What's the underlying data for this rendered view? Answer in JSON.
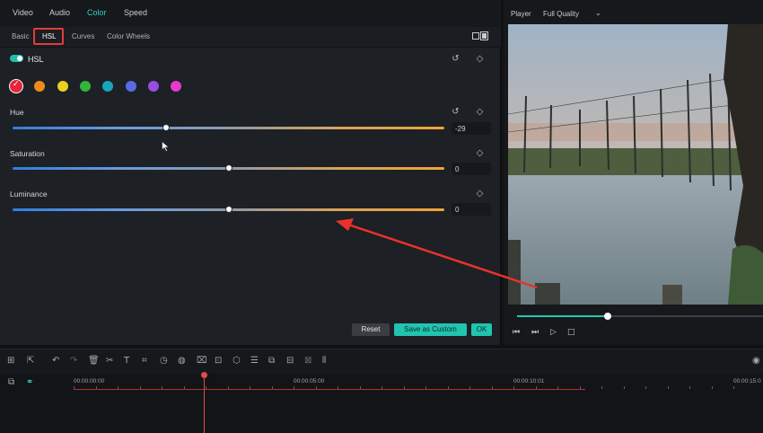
{
  "tabs": [
    {
      "label": "Video"
    },
    {
      "label": "Audio"
    },
    {
      "label": "Color"
    },
    {
      "label": "Speed"
    }
  ],
  "subtabs": [
    {
      "label": "Basic"
    },
    {
      "label": "HSL"
    },
    {
      "label": "Curves"
    },
    {
      "label": "Color Wheels"
    }
  ],
  "hsl": {
    "title": "HSL",
    "enabled": true,
    "swatch_colors": [
      "#e5253a",
      "#f08a1c",
      "#e6d21f",
      "#35b43a",
      "#17a7b7",
      "#5a6be6",
      "#9a4ee0",
      "#e33bd1"
    ],
    "selected_swatch": 0,
    "sliders": [
      {
        "label": "Hue",
        "value": "-29",
        "level": 0.355
      },
      {
        "label": "Saturation",
        "value": "0",
        "level": 0.5
      },
      {
        "label": "Luminance",
        "value": "0",
        "level": 0.5
      }
    ]
  },
  "buttons": {
    "reset": "Reset",
    "save_custom": "Save as Custom",
    "ok": "OK"
  },
  "player": {
    "label": "Player",
    "quality": "Full Quality",
    "progress": 0.37
  },
  "timeline": {
    "timecodes": [
      "00:00:00:00",
      "00:00:05:00",
      "00:00:10:01",
      "00:00:15:0"
    ]
  },
  "colors": {
    "accent": "#20c5b0",
    "highlight_box": "#e23b3b",
    "arrow": "#e8322c"
  }
}
